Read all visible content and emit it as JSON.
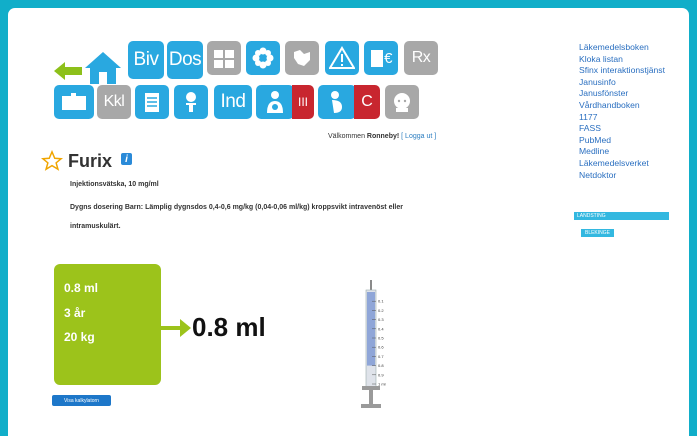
{
  "toolbar": {
    "row1": [
      "",
      "",
      "Biv",
      "Dos",
      "",
      "",
      "",
      "",
      "€",
      "Rx"
    ],
    "row2": [
      "",
      "Kkl",
      "",
      "",
      "Ind",
      "",
      "III",
      "C",
      ""
    ]
  },
  "welcome": {
    "prefix": "Välkommen",
    "user": "Ronneby!",
    "logout": "[ Logga ut ]"
  },
  "drug": {
    "name": "Furix",
    "form": "Injektionsvätska, 10 mg/ml",
    "dosage": "Dygns dosering Barn: Lämplig dygnsdos 0,4-0,6 mg/kg (0,04-0,06 ml/kg) kroppsvikt intravenöst eller intramuskulärt."
  },
  "calculator": {
    "volume": "0.8 ml",
    "age": "3 år",
    "weight": "20 kg",
    "result": "0.8 ml",
    "button": "Visa kalkylatorn",
    "fill_ml": 0.8
  },
  "syringe": {
    "ticks": [
      "0.1",
      "0.2",
      "0.3",
      "0.4",
      "0.5",
      "0.6",
      "0.7",
      "0.8",
      "0.9",
      "1 ml"
    ]
  },
  "links": [
    "Läkemedelsboken",
    "Kloka listan",
    "Sfinx interaktionstjänst",
    "Janusinfo",
    "Janusfönster",
    "Vårdhandboken",
    "1177",
    "FASS",
    "PubMed",
    "Medline",
    "Läkemedelsverket",
    "Netdoktor"
  ],
  "badges": {
    "landsting": "LANDSTING",
    "region": "BLEKINGE"
  },
  "colors": {
    "background": "#11aec9",
    "tile_blue": "#29a8e0",
    "tile_gray": "#a8a8a8",
    "accent_green": "#9cc31b",
    "accent_red": "#c8262f",
    "link": "#2a6fc0"
  }
}
